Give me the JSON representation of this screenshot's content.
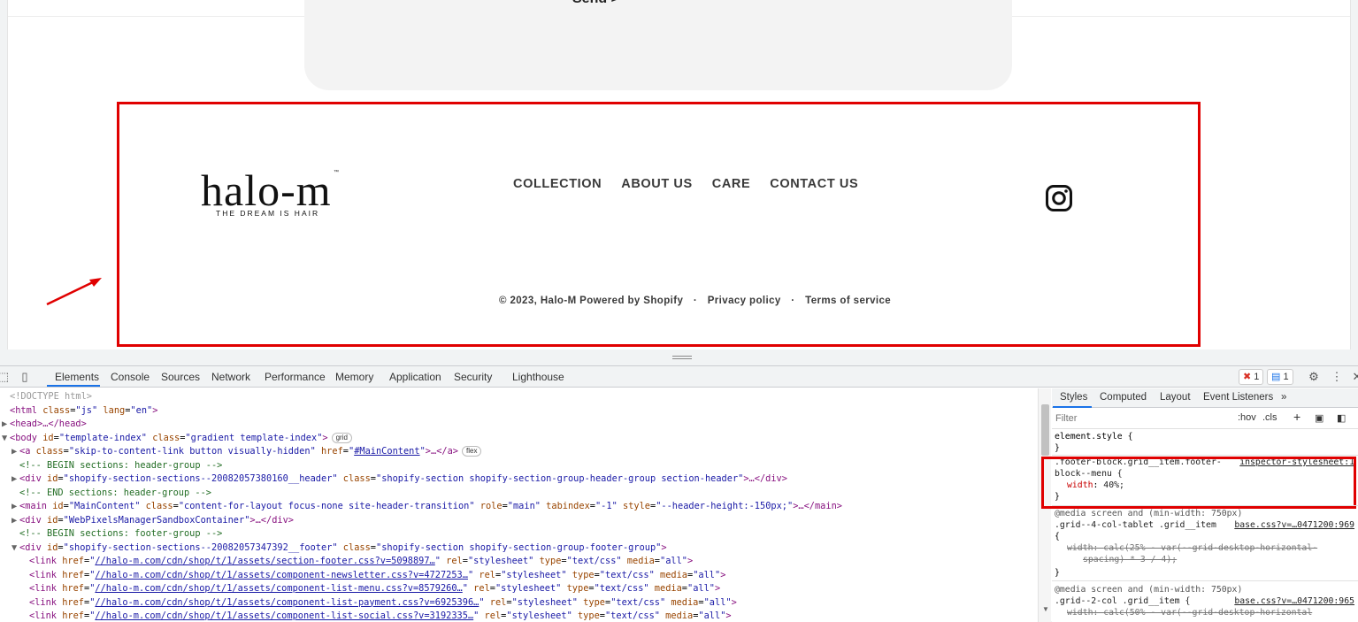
{
  "page": {
    "send_label": "Send >",
    "logo": {
      "wordmark": "halo-m",
      "tm": "™",
      "tagline": "THE DREAM IS HAIR"
    },
    "menu": [
      "COLLECTION",
      "ABOUT US",
      "CARE",
      "CONTACT US"
    ],
    "social": {
      "icon": "instagram-icon"
    },
    "copyright": "© 2023, Halo-M Powered by Shopify",
    "policy_links": [
      "Privacy policy",
      "Terms of service"
    ],
    "separator": "·",
    "annotation_color": "#e00000"
  },
  "devtools": {
    "tabs": [
      "Elements",
      "Console",
      "Sources",
      "Network",
      "Performance",
      "Memory",
      "Application",
      "Security",
      "Lighthouse"
    ],
    "active_tab": "Elements",
    "error_count": "1",
    "message_count": "1",
    "dom": [
      {
        "indent": 0,
        "tri": "",
        "html": "<!DOCTYPE html>"
      },
      {
        "indent": 0,
        "tri": "",
        "html": "<html class=\"js\" lang=\"en\">"
      },
      {
        "indent": 0,
        "tri": "▶",
        "html": "<head>…</head>"
      },
      {
        "indent": 0,
        "tri": "▼",
        "html": "<body id=\"template-index\" class=\"gradient template-index\">",
        "pill": "grid"
      },
      {
        "indent": 1,
        "tri": "▶",
        "html": "<a class=\"skip-to-content-link button visually-hidden\" href=\"#MainContent\">…</a>",
        "pill": "flex"
      },
      {
        "indent": 1,
        "tri": "",
        "html": "<!-- BEGIN sections: header-group -->"
      },
      {
        "indent": 1,
        "tri": "▶",
        "html": "<div id=\"shopify-section-sections--20082057380160__header\" class=\"shopify-section shopify-section-group-header-group section-header\">…</div>"
      },
      {
        "indent": 1,
        "tri": "",
        "html": "<!-- END sections: header-group -->"
      },
      {
        "indent": 1,
        "tri": "▶",
        "html": "<main id=\"MainContent\" class=\"content-for-layout focus-none site-header-transition\" role=\"main\" tabindex=\"-1\" style=\"--header-height:-150px;\">…</main>"
      },
      {
        "indent": 1,
        "tri": "▶",
        "html": "<div id=\"WebPixelsManagerSandboxContainer\">…</div>"
      },
      {
        "indent": 1,
        "tri": "",
        "html": "<!-- BEGIN sections: footer-group -->"
      },
      {
        "indent": 1,
        "tri": "▼",
        "html": "<div id=\"shopify-section-sections--20082057347392__footer\" class=\"shopify-section shopify-section-group-footer-group\">"
      },
      {
        "indent": 2,
        "tri": "",
        "html": "<link href=\"//halo-m.com/cdn/shop/t/1/assets/section-footer.css?v=5098897…\" rel=\"stylesheet\" type=\"text/css\" media=\"all\">"
      },
      {
        "indent": 2,
        "tri": "",
        "html": "<link href=\"//halo-m.com/cdn/shop/t/1/assets/component-newsletter.css?v=4727253…\" rel=\"stylesheet\" type=\"text/css\" media=\"all\">"
      },
      {
        "indent": 2,
        "tri": "",
        "html": "<link href=\"//halo-m.com/cdn/shop/t/1/assets/component-list-menu.css?v=8579260…\" rel=\"stylesheet\" type=\"text/css\" media=\"all\">"
      },
      {
        "indent": 2,
        "tri": "",
        "html": "<link href=\"//halo-m.com/cdn/shop/t/1/assets/component-list-payment.css?v=6925396…\" rel=\"stylesheet\" type=\"text/css\" media=\"all\">"
      },
      {
        "indent": 2,
        "tri": "",
        "html": "<link href=\"//halo-m.com/cdn/shop/t/1/assets/component-list-social.css?v=3192335…\" rel=\"stylesheet\" type=\"text/css\" media=\"all\">"
      }
    ],
    "styles": {
      "tabs": [
        "Styles",
        "Computed",
        "Layout",
        "Event Listeners",
        "»"
      ],
      "filter_placeholder": "Filter",
      "hov": ":hov",
      "cls": ".cls",
      "element_style": "element.style {",
      "close_brace": "}",
      "rule1_selector_a": ".footer-block.grid__item.footer-",
      "rule1_selector_b": "block--menu {",
      "rule1_source": "inspector-stylesheet:1",
      "rule1_prop": "width",
      "rule1_value": "40%;",
      "media": "@media screen and (min-width: 750px)",
      "rule2_selector": ".grid--4-col-tablet .grid__item",
      "rule2_source": "base.css?v=…0471200:969",
      "open_brace": "{",
      "rule2_prop": "width",
      "rule2_value_a": "calc(25% - var(--grid-desktop-horizontal-",
      "rule2_value_b": "spacing) * 3 / 4);",
      "rule3_selector": ".grid--2-col .grid__item {",
      "rule3_source": "base.css?v=…0471200:965",
      "rule3_value": "width: calc(50% - var(--grid-desktop-horizontal"
    }
  }
}
